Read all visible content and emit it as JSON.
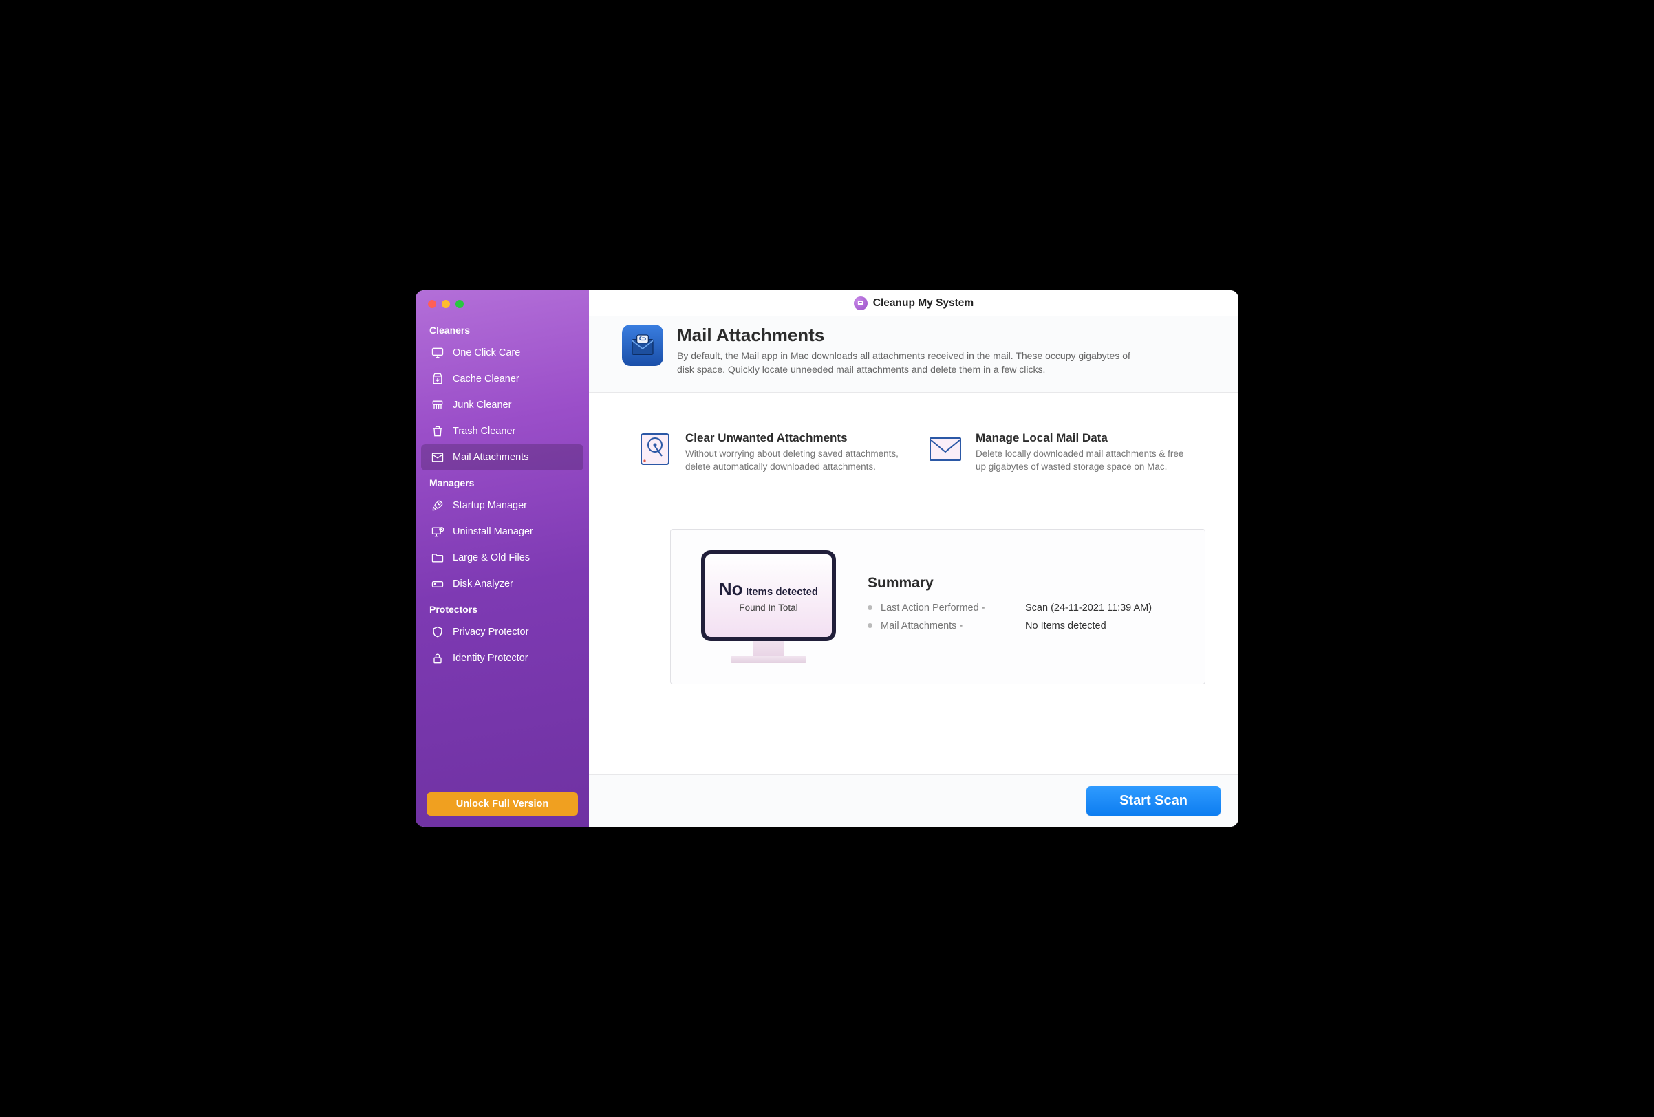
{
  "app": {
    "title": "Cleanup My System"
  },
  "sidebar": {
    "sections": {
      "cleaners": {
        "label": "Cleaners"
      },
      "managers": {
        "label": "Managers"
      },
      "protectors": {
        "label": "Protectors"
      }
    },
    "items": {
      "one_click_care": "One Click Care",
      "cache_cleaner": "Cache Cleaner",
      "junk_cleaner": "Junk Cleaner",
      "trash_cleaner": "Trash Cleaner",
      "mail_attachments": "Mail Attachments",
      "startup_manager": "Startup Manager",
      "uninstall_manager": "Uninstall Manager",
      "large_old_files": "Large & Old Files",
      "disk_analyzer": "Disk Analyzer",
      "privacy_protector": "Privacy Protector",
      "identity_protector": "Identity Protector"
    },
    "unlock_label": "Unlock Full Version"
  },
  "page": {
    "title": "Mail Attachments",
    "description": "By default, the Mail app in Mac downloads all attachments received in the mail. These occupy gigabytes of disk space. Quickly locate unneeded mail attachments and delete them in a few clicks."
  },
  "features": {
    "clear": {
      "title": "Clear Unwanted Attachments",
      "desc": "Without worrying about deleting saved attachments, delete automatically downloaded attachments."
    },
    "manage": {
      "title": "Manage Local Mail Data",
      "desc": "Delete locally downloaded mail attachments & free up gigabytes of wasted storage space on Mac."
    }
  },
  "summary": {
    "title": "Summary",
    "monitor_big": "No",
    "monitor_rest": "Items detected",
    "monitor_sub": "Found In Total",
    "rows": {
      "last_action": {
        "label": "Last Action Performed -",
        "value": "Scan (24-11-2021 11:39 AM)"
      },
      "mail_attachments": {
        "label": "Mail Attachments -",
        "value": "No Items detected"
      }
    }
  },
  "footer": {
    "start_scan": "Start Scan"
  }
}
